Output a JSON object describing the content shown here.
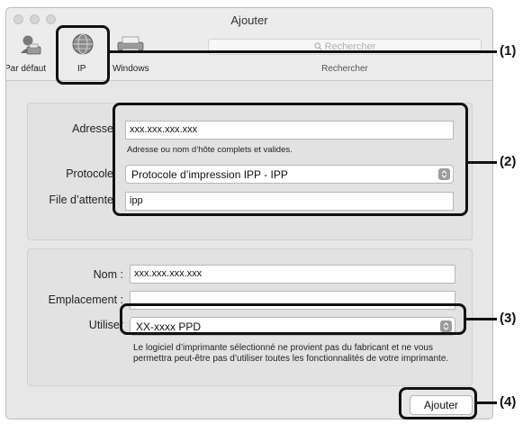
{
  "window": {
    "title": "Ajouter"
  },
  "toolbar": {
    "items": [
      {
        "label": "Par défaut",
        "icon": "default-printer-icon"
      },
      {
        "label": "IP",
        "icon": "globe-icon"
      },
      {
        "label": "Windows",
        "icon": "windows-printer-icon"
      }
    ],
    "search": {
      "placeholder": "Rechercher",
      "caption": "Rechercher",
      "icon": "search-icon"
    }
  },
  "connection": {
    "address_label": "Adresse",
    "address_value": "xxx.xxx.xxx.xxx",
    "address_hint": "Adresse ou nom d’hôte complets et valides.",
    "protocol_label": "Protocole",
    "protocol_value": "Protocole d’impression IPP - IPP",
    "queue_label": "File d’attente",
    "queue_value": "ipp"
  },
  "printer": {
    "name_label": "Nom :",
    "name_value": "xxx.xxx.xxx.xxx",
    "location_label": "Emplacement :",
    "location_value": "",
    "use_label": "Utiliser",
    "use_value": "XX-xxxx PPD",
    "description": "Le logiciel d’imprimante sélectionné ne provient pas du fabricant et ne vous permettra peut-être pas d’utiliser toutes les fonctionnalités de votre imprimante."
  },
  "add_button": {
    "label": "Ajouter"
  },
  "callouts": [
    "(1)",
    "(2)",
    "(3)",
    "(4)"
  ],
  "colors": {
    "window_bg": "#ececec",
    "group_bg": "#e2e2e2",
    "callout": "#111111"
  }
}
